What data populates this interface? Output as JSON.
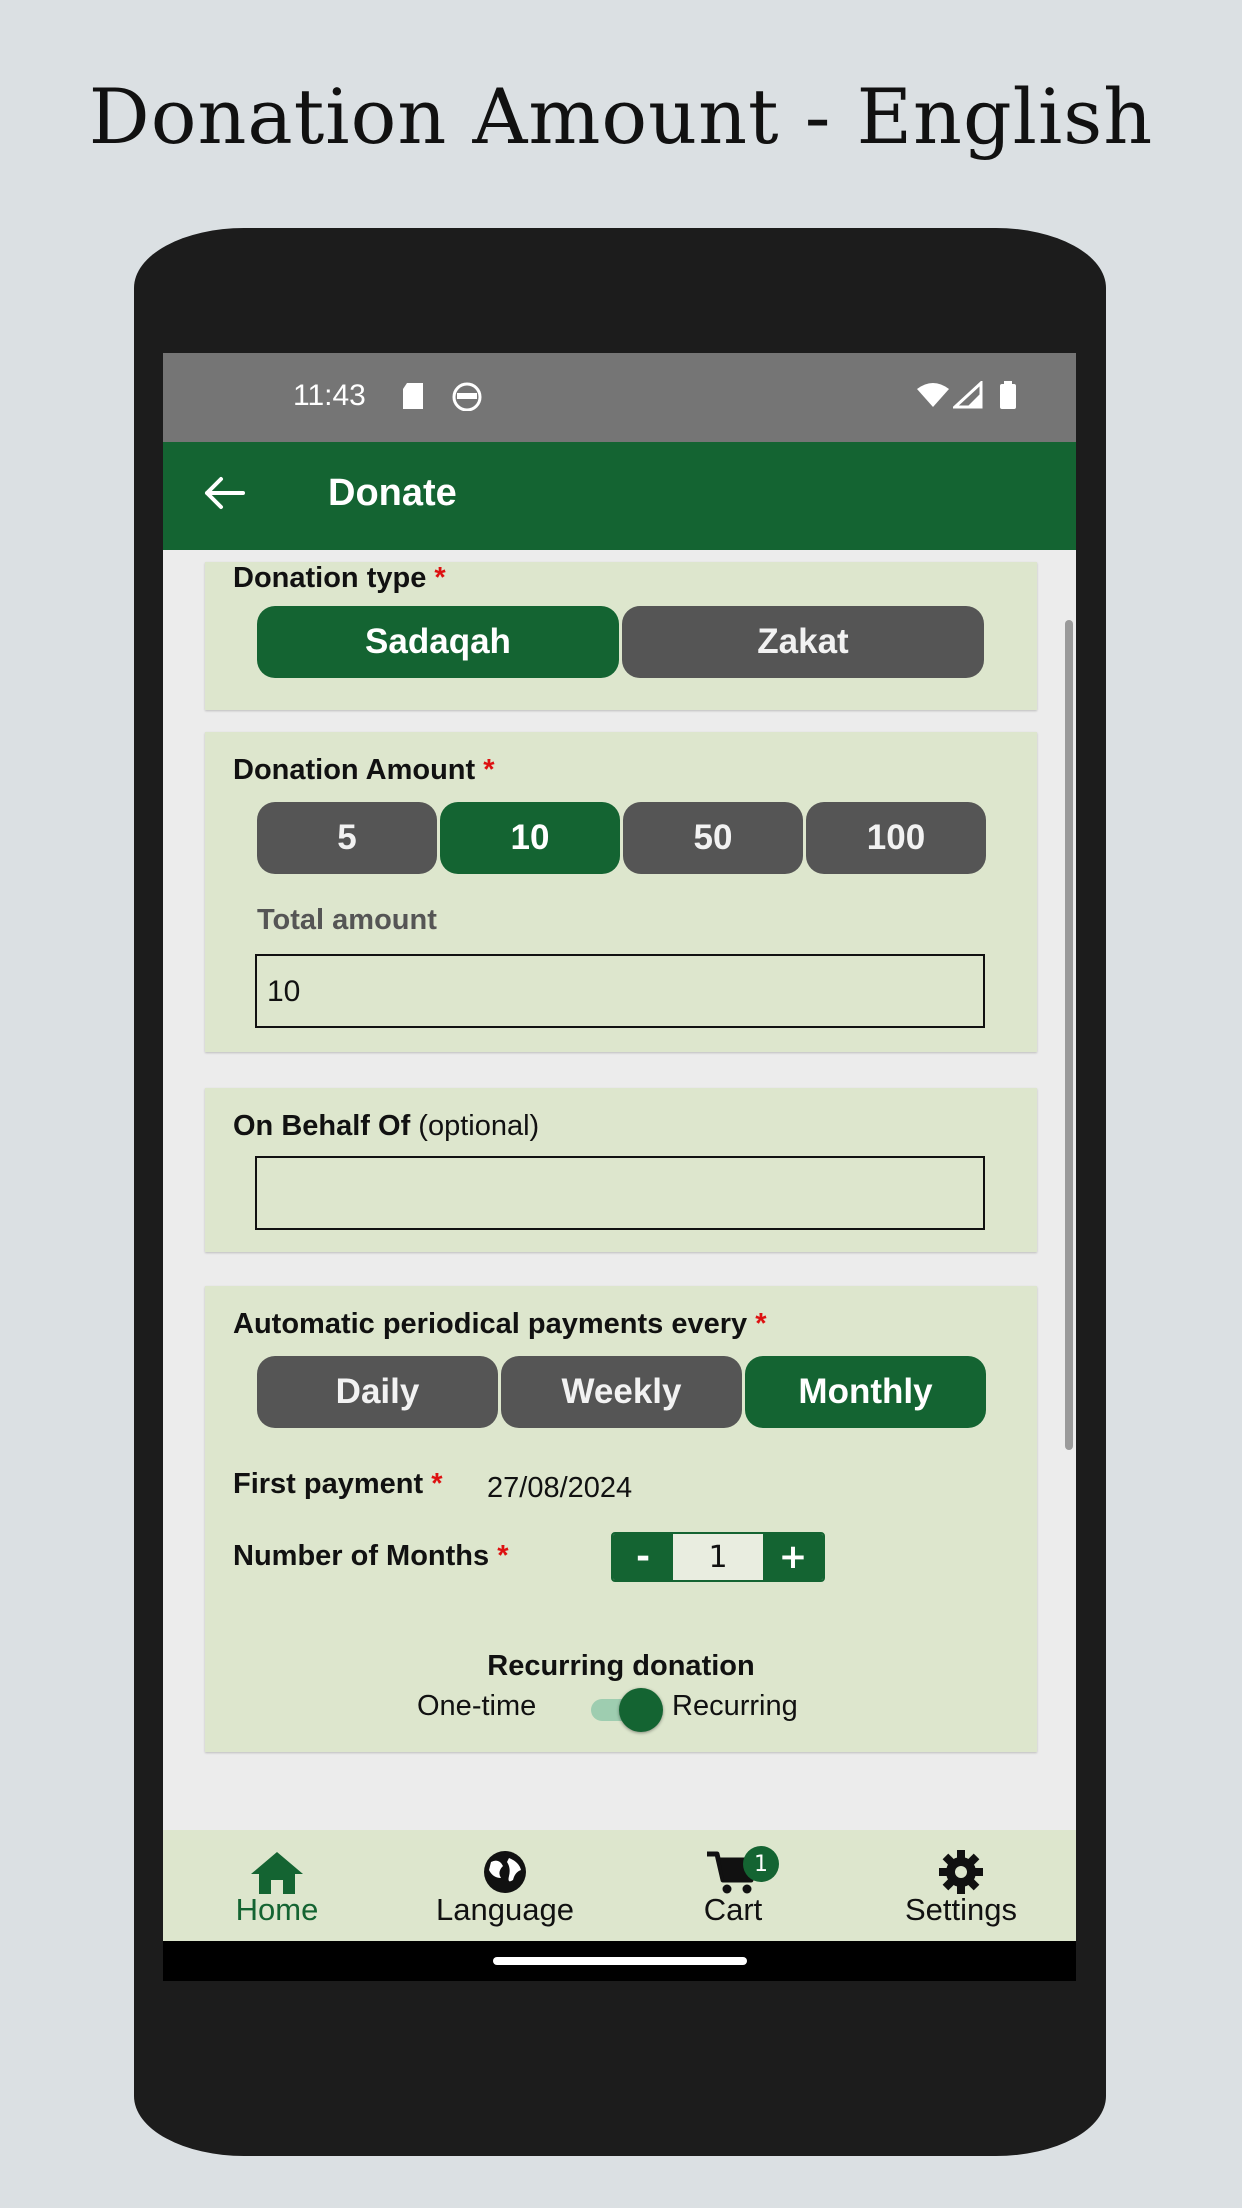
{
  "headline": "Donation Amount - English",
  "status_bar": {
    "time": "11:43"
  },
  "app_bar": {
    "title": "Donate"
  },
  "donation_type": {
    "label": "Donation type",
    "required_mark": "*",
    "options": [
      "Sadaqah",
      "Zakat"
    ],
    "selected": "Sadaqah"
  },
  "donation_amount": {
    "label": "Donation Amount",
    "required_mark": "*",
    "options": [
      "5",
      "10",
      "50",
      "100"
    ],
    "selected": "10",
    "total_label": "Total amount",
    "total_value": "10"
  },
  "on_behalf": {
    "label": "On Behalf Of",
    "optional_text": "(optional)",
    "value": ""
  },
  "periodic": {
    "label": "Automatic periodical payments every",
    "required_mark": "*",
    "options": [
      "Daily",
      "Weekly",
      "Monthly"
    ],
    "selected": "Monthly",
    "first_payment_label": "First payment",
    "first_payment_value": "27/08/2024",
    "months_label": "Number of Months",
    "months_value": "1",
    "minus": "-",
    "plus": "+",
    "recurring_title": "Recurring donation",
    "one_time_label": "One-time",
    "recurring_label": "Recurring",
    "recurring_enabled": true
  },
  "bottom_nav": {
    "items": [
      {
        "label": "Home",
        "icon": "home-icon",
        "active": true
      },
      {
        "label": "Language",
        "icon": "globe-icon",
        "active": false
      },
      {
        "label": "Cart",
        "icon": "cart-icon",
        "active": false,
        "badge": "1"
      },
      {
        "label": "Settings",
        "icon": "gear-icon",
        "active": false
      }
    ]
  },
  "colors": {
    "primary": "#146432",
    "card_bg": "#dde6cd",
    "inactive_btn": "#555555",
    "required": "#dd1111"
  }
}
